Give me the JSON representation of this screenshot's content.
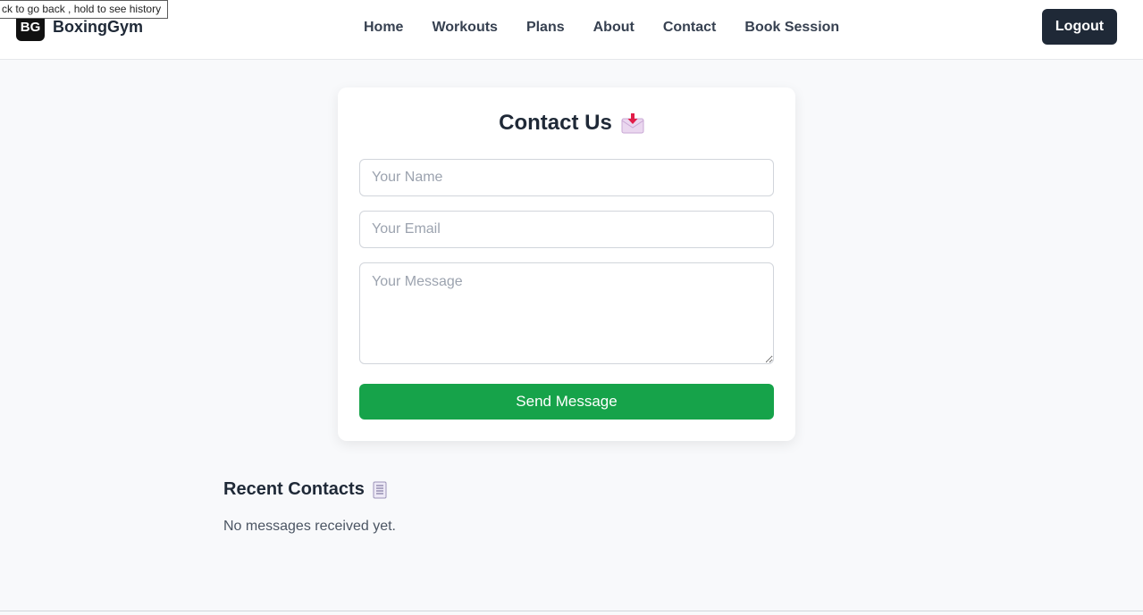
{
  "tooltip": "ck to go back , hold to see history",
  "brand": {
    "logo": "BG",
    "name": "BoxingGym"
  },
  "nav": {
    "links": [
      "Home",
      "Workouts",
      "Plans",
      "About",
      "Contact",
      "Book Session"
    ],
    "logout_label": "Logout"
  },
  "contact": {
    "title": "Contact Us",
    "title_icon": "incoming-envelope-icon",
    "name_placeholder": "Your Name",
    "name_value": "",
    "email_placeholder": "Your Email",
    "email_value": "",
    "message_placeholder": "Your Message",
    "message_value": "",
    "send_label": "Send Message"
  },
  "recent": {
    "title": "Recent Contacts",
    "title_icon": "ledger-icon",
    "empty_text": "No messages received yet."
  },
  "colors": {
    "accent_green": "#16a34a",
    "dark": "#1f2937",
    "background": "#f8f9fb"
  }
}
